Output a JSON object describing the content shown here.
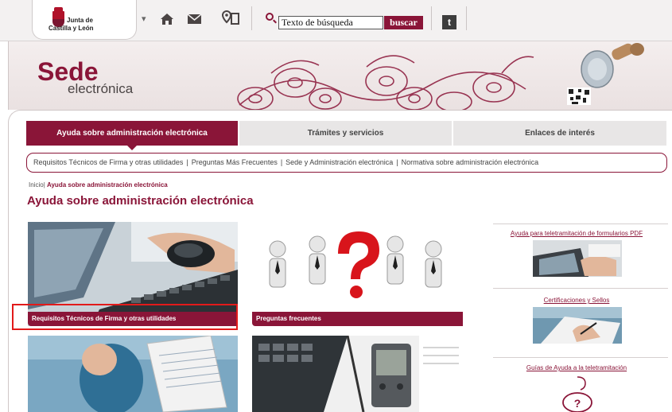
{
  "header": {
    "logo_line1": "Junta de",
    "logo_line2": "Castilla y León",
    "search_placeholder": "Texto de búsqueda",
    "search_button": "buscar",
    "twitter_glyph": "t"
  },
  "icons": [
    "home-icon",
    "mail-icon",
    "map-icon",
    "search-icon",
    "twitter-icon"
  ],
  "banner": {
    "title": "Sede",
    "subtitle": "electrónica"
  },
  "tabs": [
    {
      "label": "Ayuda sobre administración electrónica",
      "active": true
    },
    {
      "label": "Trámites y servicios",
      "active": false
    },
    {
      "label": "Enlaces de interés",
      "active": false
    }
  ],
  "subnav": [
    "Requisitos Técnicos de Firma y otras utilidades",
    "Preguntas Más Frecuentes",
    "Sede y Administración electrónica",
    "Normativa sobre administración electrónica"
  ],
  "breadcrumb": {
    "home": "Inicio",
    "current": "Ayuda sobre administración electrónica"
  },
  "page_title": "Ayuda sobre administración electrónica",
  "tiles": [
    {
      "caption": "Requisitos Técnicos de Firma y otras utilidades"
    },
    {
      "caption": "Preguntas frecuentes"
    }
  ],
  "right_links": [
    "Ayuda para teletramitación de formularios PDF",
    "Certificaciones y Sellos",
    "Guías de Ayuda a la teletramitación"
  ],
  "colors": {
    "brand": "#8a1538",
    "highlight": "#e21a1a"
  }
}
